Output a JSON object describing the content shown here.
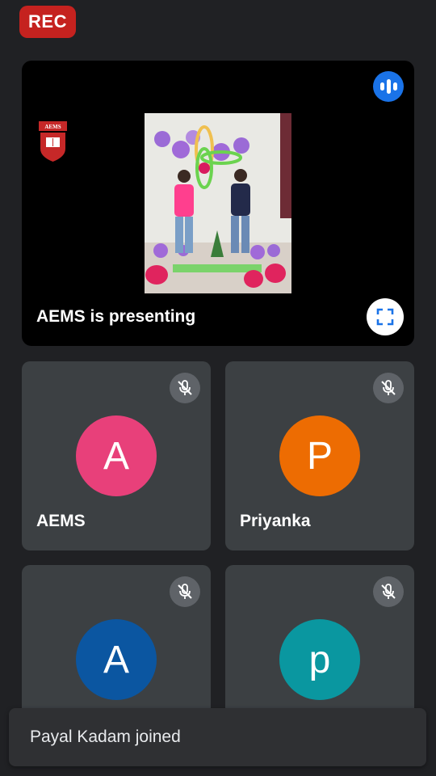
{
  "recording": {
    "label": "REC",
    "color": "#c5221f"
  },
  "presenter": {
    "label": "AEMS is presenting",
    "logo_text": "AEMS",
    "speaking_icon": "audio-bars-icon",
    "fullscreen_icon": "fullscreen-icon"
  },
  "participants": [
    {
      "name": "AEMS",
      "initial": "A",
      "color": "#e8407a",
      "muted": true
    },
    {
      "name": "Priyanka",
      "initial": "P",
      "color": "#ed6c02",
      "muted": true
    },
    {
      "name": "",
      "initial": "A",
      "color": "#0b56a1",
      "muted": true
    },
    {
      "name": "",
      "initial": "p",
      "color": "#0a97a0",
      "muted": true
    }
  ],
  "toast": {
    "message": "Payal Kadam joined"
  }
}
